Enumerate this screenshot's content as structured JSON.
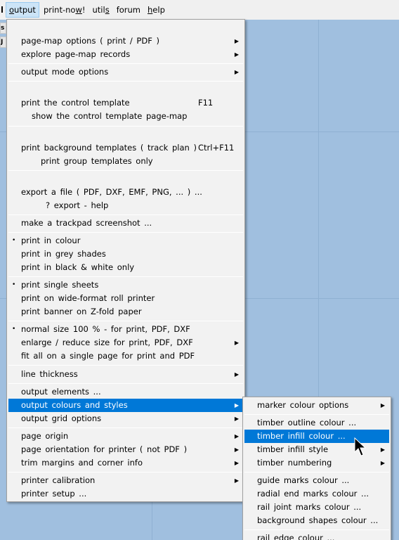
{
  "menubar": {
    "stub_label": "l",
    "items": [
      {
        "label": "output",
        "underline_index": 0,
        "active": true
      },
      {
        "label": "print-now!",
        "underline_index": 8
      },
      {
        "label": "utils",
        "underline_index": 4
      },
      {
        "label": "forum",
        "underline_index": -1
      },
      {
        "label": "help",
        "underline_index": 0
      }
    ]
  },
  "left_strip": {
    "btn1": "s",
    "btn2": "J"
  },
  "main_menu": {
    "items": [
      {
        "label": "page-map  options  ( print / PDF )",
        "submenu": true
      },
      {
        "label": "explore  page-map  records",
        "submenu": true
      },
      {
        "label": "output  mode  options",
        "submenu": true
      },
      {
        "label": "print  the  control  template",
        "shortcut": "F11"
      },
      {
        "label": "show  the  control  template  page-map"
      },
      {
        "label": "print  background  templates  ( track  plan )",
        "shortcut": "Ctrl+F11"
      },
      {
        "label": "print  group  templates  only"
      },
      {
        "label": "export  a  file  ( PDF,  DXF,  EMF,  PNG, ... ) ..."
      },
      {
        "label": "?  export  -  help"
      },
      {
        "label": "make  a  trackpad  screenshot ..."
      },
      {
        "label": "print  in  colour",
        "checked": true
      },
      {
        "label": "print  in  grey  shades"
      },
      {
        "label": "print  in  black  &  white  only"
      },
      {
        "label": "print  single  sheets",
        "checked": true
      },
      {
        "label": "print  on  wide-format  roll  printer"
      },
      {
        "label": "print  banner  on  Z-fold  paper"
      },
      {
        "label": "normal  size  100 %   -  for  print,  PDF,  DXF",
        "checked": true
      },
      {
        "label": "enlarge / reduce  size  for  print,  PDF,  DXF",
        "submenu": true
      },
      {
        "label": "fit  all  on  a  single  page  for  print  and  PDF"
      },
      {
        "label": "line  thickness",
        "submenu": true
      },
      {
        "label": "output  elements ..."
      },
      {
        "label": "output  colours  and  styles",
        "submenu": true,
        "highlighted": true
      },
      {
        "label": "output  grid  options",
        "submenu": true
      },
      {
        "label": "page  origin",
        "submenu": true
      },
      {
        "label": "page  orientation  for  printer  ( not  PDF )",
        "submenu": true
      },
      {
        "label": "trim  margins  and  corner  info",
        "submenu": true
      },
      {
        "label": "printer  calibration",
        "submenu": true
      },
      {
        "label": "printer  setup ..."
      }
    ]
  },
  "sub_menu": {
    "items": [
      {
        "label": "marker  colour  options",
        "submenu": true
      },
      {
        "label": "timber  outline  colour ..."
      },
      {
        "label": "timber  infill  colour ...",
        "highlighted": true
      },
      {
        "label": "timber  infill  style",
        "submenu": true
      },
      {
        "label": "timber  numbering",
        "submenu": true
      },
      {
        "label": "guide  marks  colour ..."
      },
      {
        "label": "radial  end  marks  colour ..."
      },
      {
        "label": "rail  joint  marks  colour ..."
      },
      {
        "label": "background  shapes  colour ..."
      },
      {
        "label": "rail  edge  colour ..."
      }
    ]
  },
  "icons": {
    "bullet": "•",
    "submenu_arrow": "▶"
  },
  "colors": {
    "highlight": "#0078d7",
    "background": "#a0bfdf",
    "menu_bg": "#f2f2f2"
  }
}
